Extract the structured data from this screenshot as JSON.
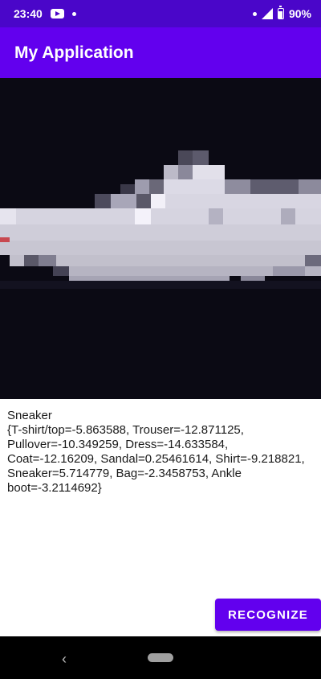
{
  "status_bar": {
    "time": "23:40",
    "notification_icons": [
      "youtube-icon",
      "dot-icon"
    ],
    "status_icons": [
      "dot-icon",
      "signal-icon",
      "battery-icon"
    ],
    "battery": "90%"
  },
  "app_bar": {
    "title": "My Application"
  },
  "image_view": {
    "content": "pixelated sneaker image",
    "background": "#0b0a14"
  },
  "result": {
    "label": "Sneaker",
    "scores": "{T-shirt/top=-5.863588, Trouser=-12.871125, Pullover=-10.349259, Dress=-14.633584, Coat=-12.16209, Sandal=0.25461614, Shirt=-9.218821, Sneaker=5.714779, Bag=-2.3458753, Ankle boot=-3.2114692}"
  },
  "actions": {
    "recognize_label": "RECOGNIZE"
  },
  "colors": {
    "primary": "#6200ee",
    "primary_dark": "#4a06c9"
  },
  "nav_bar": {
    "icons": [
      "back-icon",
      "home-pill-icon"
    ]
  }
}
